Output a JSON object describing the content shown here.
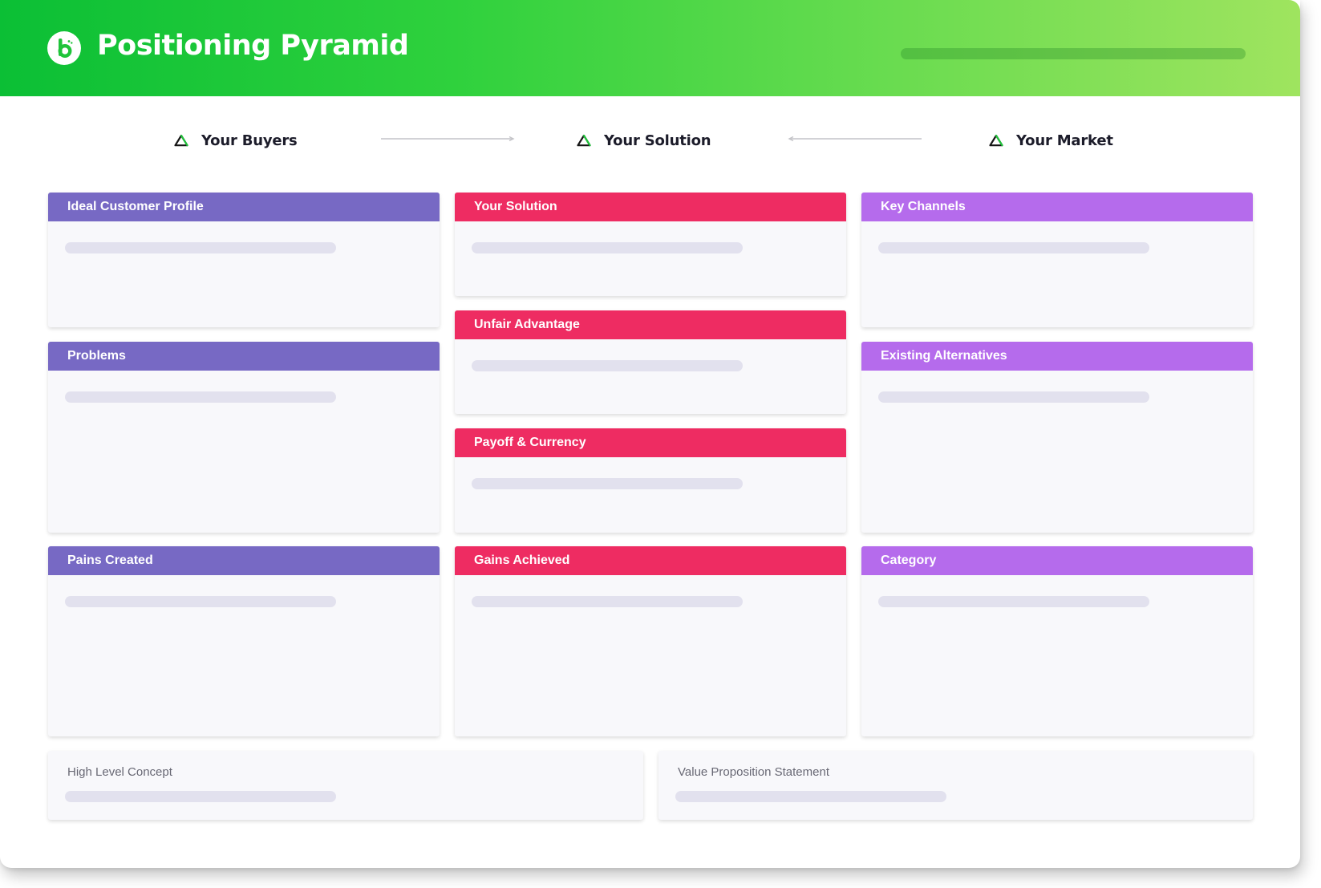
{
  "header": {
    "title": "Positioning Pyramid",
    "logo_icon": "b-logo-icon",
    "colors": {
      "start": "#0bbf35",
      "end": "#9fe45f"
    }
  },
  "flow": {
    "buyers": "Your Buyers",
    "solution": "Your Solution",
    "market": "Your Market",
    "icon": "triangle-outline-icon"
  },
  "columns": {
    "buyers": {
      "color": "#7769c4",
      "cards": [
        "Ideal Customer Profile",
        "Problems",
        "Pains Created"
      ]
    },
    "solution": {
      "color": "#ee2c62",
      "cards": [
        "Your Solution",
        "Unfair Advantage",
        "Payoff & Currency",
        "Gains Achieved"
      ]
    },
    "market": {
      "color": "#b56bec",
      "cards": [
        "Key Channels",
        "Existing Alternatives",
        "Category"
      ]
    }
  },
  "bottom": {
    "concept": "High Level Concept",
    "value_prop": "Value Proposition Statement"
  }
}
